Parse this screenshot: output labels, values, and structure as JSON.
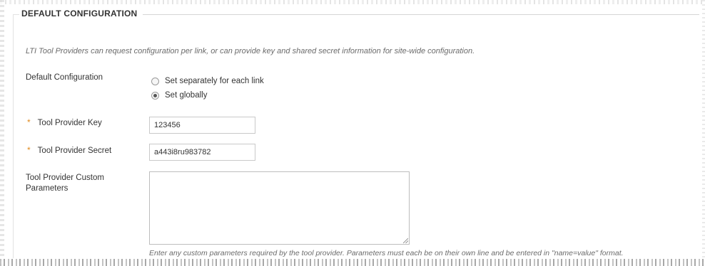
{
  "section": {
    "title": "DEFAULT CONFIGURATION",
    "help_text": "LTI Tool Providers can request configuration per link, or can provide key and shared secret information for site-wide configuration."
  },
  "default_configuration": {
    "label": "Default Configuration",
    "options": [
      {
        "label": "Set separately for each link",
        "selected": false
      },
      {
        "label": "Set globally",
        "selected": true
      }
    ]
  },
  "tool_provider_key": {
    "required_marker": "*",
    "label": "Tool Provider Key",
    "value": "123456"
  },
  "tool_provider_secret": {
    "required_marker": "*",
    "label": "Tool Provider Secret",
    "value": "a443i8ru983782"
  },
  "custom_parameters": {
    "label": "Tool Provider Custom Parameters",
    "value": "",
    "help_text": "Enter any custom parameters required by the tool provider. Parameters must each be on their own line and be entered in \"name=value\" format."
  },
  "colors": {
    "required_marker": "#e08a1e",
    "help_text": "#6b6b6b",
    "text": "#333333"
  }
}
